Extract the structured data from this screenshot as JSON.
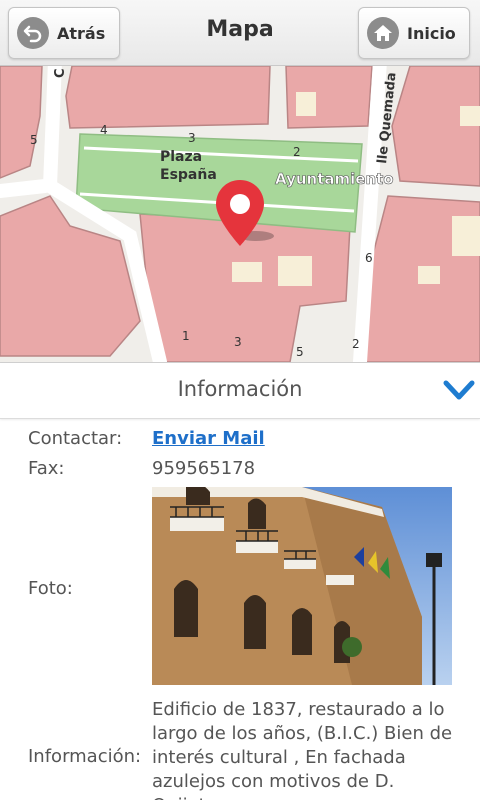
{
  "header": {
    "title": "Mapa",
    "back_label": "Atrás",
    "home_label": "Inicio"
  },
  "map": {
    "labels": {
      "plaza_line1": "Plaza",
      "plaza_line2": "España",
      "ayuntamiento": "Ayuntamiento",
      "street": "lle Quemada",
      "street_left": "C"
    },
    "numbers": [
      "5",
      "4",
      "3",
      "2",
      "6",
      "1",
      "3",
      "5",
      "2"
    ]
  },
  "panel": {
    "title": "Información",
    "contact_label": "Contactar:",
    "contact_value": "Enviar Mail",
    "fax_label": "Fax:",
    "fax_value": "959565178",
    "photo_label": "Foto:",
    "info_label": "Información:",
    "info_value": "Edificio de 1837, restaurado a lo largo de los años, (B.I.C.) Bien de interés cultural , En fachada azulejos con motivos de D. Quijote"
  },
  "colors": {
    "building": "#e9a8a8",
    "building_stroke": "#b98585",
    "plaza": "#a8d79a",
    "road": "#ffffff",
    "marker": "#e5343c",
    "link": "#1e6fc9",
    "chevron": "#1e7cd0"
  }
}
